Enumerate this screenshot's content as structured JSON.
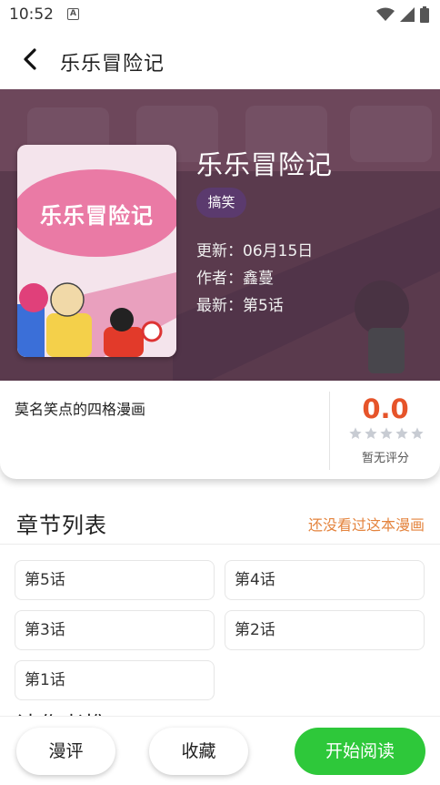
{
  "status_bar": {
    "time": "10:52",
    "notification_icon": "a-icon",
    "icons": [
      "wifi-icon",
      "signal-icon",
      "battery-icon"
    ]
  },
  "app_bar": {
    "back_icon": "chevron-left-icon",
    "title": "乐乐冒险记"
  },
  "comic": {
    "title": "乐乐冒险记",
    "cover_title": "乐乐冒险记",
    "genre_tag": "搞笑",
    "updated": "更新：06月15日",
    "author": "作者：鑫蔓",
    "latest": "最新：第5话",
    "description": "莫名笑点的四格漫画"
  },
  "rating": {
    "score": "0.0",
    "stars_filled": 0,
    "stars_total": 5,
    "label": "暂无评分"
  },
  "chapters": {
    "title": "章节列表",
    "hint": "还没看过这本漫画",
    "items": [
      "第5话",
      "第4话",
      "第3话",
      "第2话",
      "第1话"
    ]
  },
  "next_section_title": "读作者推",
  "bottom_bar": {
    "review_label": "漫评",
    "favorite_label": "收藏",
    "read_label": "开始阅读"
  },
  "colors": {
    "accent_green": "#2ec83a",
    "score_orange": "#e6542a",
    "hint_orange": "#e4843e",
    "tag_purple": "#5b3a6e"
  }
}
